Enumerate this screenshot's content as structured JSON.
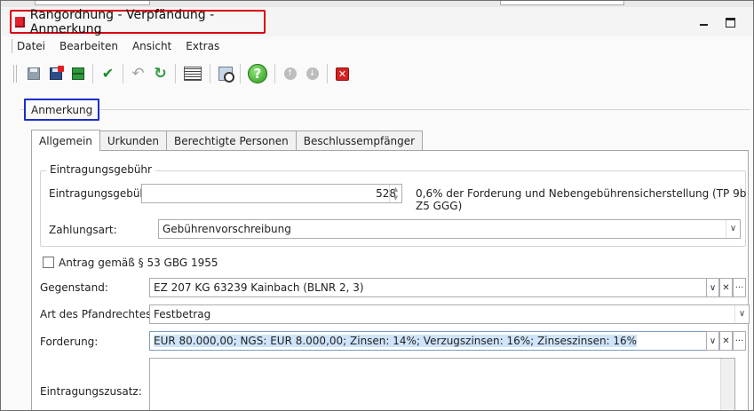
{
  "window": {
    "title": "Rangordnung - Verpfändung - Anmerkung",
    "minimize_glyph": "",
    "maximize_glyph": ""
  },
  "menu": [
    "Datei",
    "Bearbeiten",
    "Ansicht",
    "Extras"
  ],
  "toolbar": {
    "icons": [
      "save-icon",
      "save-close-icon",
      "grid-icon",
      "check-icon",
      "undo-icon",
      "redo-icon",
      "calculator-icon",
      "search-document-icon",
      "help-icon",
      "arrow-up-icon",
      "arrow-down-icon",
      "close-icon"
    ],
    "help_glyph": "?",
    "up_glyph": "↑",
    "down_glyph": "↓",
    "close_glyph": "✕",
    "check_glyph": "✔",
    "undo_glyph": "↶",
    "redo_glyph": "↻"
  },
  "section_label": "Anmerkung",
  "tabs": [
    "Allgemein",
    "Urkunden",
    "Berechtigte Personen",
    "Beschlussempfänger"
  ],
  "active_tab": "Allgemein",
  "fees": {
    "legend": "Eintragungsgebühr",
    "fee_label": "Eintragungsgebühr:",
    "fee_value": "528",
    "fee_hint": "0,6% der Forderung und Nebengebührensicherstellung (TP 9b Z5 GGG)",
    "payment_label": "Zahlungsart:",
    "payment_value": "Gebührenvorschreibung"
  },
  "checkbox": {
    "label": "Antrag gemäß § 53 GBG 1955",
    "checked": false
  },
  "fields": {
    "gegenstand_label": "Gegenstand:",
    "gegenstand_value": "EZ 207 KG 63239 Kainbach (BLNR 2, 3)",
    "pfandrecht_label": "Art des Pfandrechtes:",
    "pfandrecht_value": "Festbetrag",
    "forderung_label": "Forderung:",
    "forderung_value": "EUR 80.000,00; NGS: EUR 8.000,00; Zinsen: 14%; Verzugszinsen: 16%; Zinseszinsen: 16%",
    "zusatz_label": "Eintragungszusatz:"
  },
  "buttons": {
    "dropdown_glyph": "∨",
    "clear_glyph": "✕",
    "more_glyph": "···",
    "spin_up": "▲",
    "spin_down": "▼"
  },
  "colors": {
    "title_highlight": "#d8000f",
    "section_highlight": "#1a2fc8",
    "app_icon": "#e2202e"
  }
}
